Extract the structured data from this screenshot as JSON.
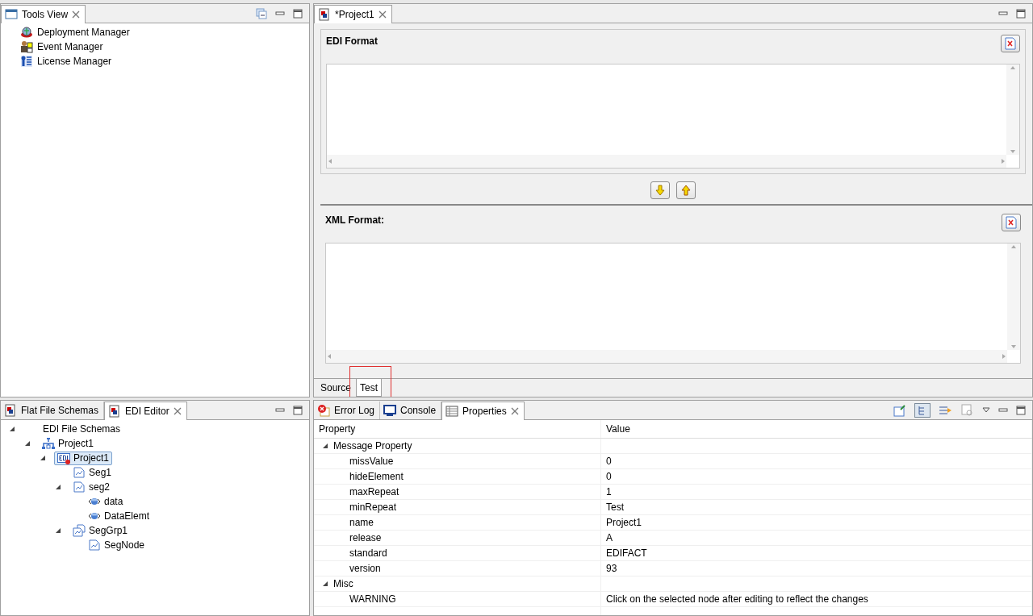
{
  "tools_view": {
    "tabs": [
      {
        "label": "Tools View",
        "selected": true
      }
    ],
    "items": [
      {
        "label": "Deployment Manager",
        "kind": "deploy"
      },
      {
        "label": "Event Manager",
        "kind": "event"
      },
      {
        "label": "License Manager",
        "kind": "license"
      }
    ]
  },
  "editor": {
    "tabs": [
      {
        "label": "*Project1",
        "selected": true
      }
    ],
    "edi_format": {
      "title": "EDI Format"
    },
    "xml_format": {
      "title": "XML Format:"
    },
    "bottom_tabs": [
      {
        "label": "Source",
        "selected": false,
        "highlighted": false
      },
      {
        "label": "Test",
        "selected": true,
        "highlighted": true
      }
    ]
  },
  "schema_view": {
    "tabs": [
      {
        "label": "Flat File Schemas",
        "selected": false
      },
      {
        "label": "EDI Editor",
        "selected": true
      }
    ],
    "tree": [
      {
        "label": "EDI File Schemas",
        "selected": false,
        "expanded": true,
        "children": [
          {
            "label": "Project1",
            "kind": "project",
            "selected": false,
            "expanded": true,
            "children": [
              {
                "label": "Project1",
                "kind": "edi",
                "selected": true,
                "expanded": true,
                "children": [
                  {
                    "label": "Seg1",
                    "kind": "segment",
                    "selected": false
                  },
                  {
                    "label": "seg2",
                    "kind": "segment",
                    "selected": false,
                    "expanded": true,
                    "children": [
                      {
                        "label": "data",
                        "kind": "data",
                        "selected": false
                      },
                      {
                        "label": "DataElemt",
                        "kind": "data",
                        "selected": false
                      }
                    ]
                  },
                  {
                    "label": "SegGrp1",
                    "kind": "group",
                    "selected": false,
                    "expanded": true,
                    "children": [
                      {
                        "label": "SegNode",
                        "kind": "segment",
                        "selected": false
                      }
                    ]
                  }
                ]
              }
            ]
          }
        ]
      }
    ]
  },
  "properties_view": {
    "tabs": [
      {
        "label": "Error Log",
        "selected": false,
        "kind": "error"
      },
      {
        "label": "Console",
        "selected": false,
        "kind": "console"
      },
      {
        "label": "Properties",
        "selected": true,
        "kind": "properties"
      }
    ],
    "columns": [
      "Property",
      "Value"
    ],
    "groups": [
      {
        "label": "Message Property",
        "expanded": true,
        "rows": [
          {
            "property": "missValue",
            "value": "0"
          },
          {
            "property": "hideElement",
            "value": "0"
          },
          {
            "property": "maxRepeat",
            "value": "1"
          },
          {
            "property": "minRepeat",
            "value": "Test"
          },
          {
            "property": "name",
            "value": "Project1"
          },
          {
            "property": "release",
            "value": "A"
          },
          {
            "property": "standard",
            "value": "EDIFACT"
          },
          {
            "property": "version",
            "value": "93"
          }
        ]
      },
      {
        "label": "Misc",
        "expanded": true,
        "rows": [
          {
            "property": "WARNING",
            "value": "Click on the selected node after editing to reflect the changes"
          }
        ]
      }
    ]
  }
}
